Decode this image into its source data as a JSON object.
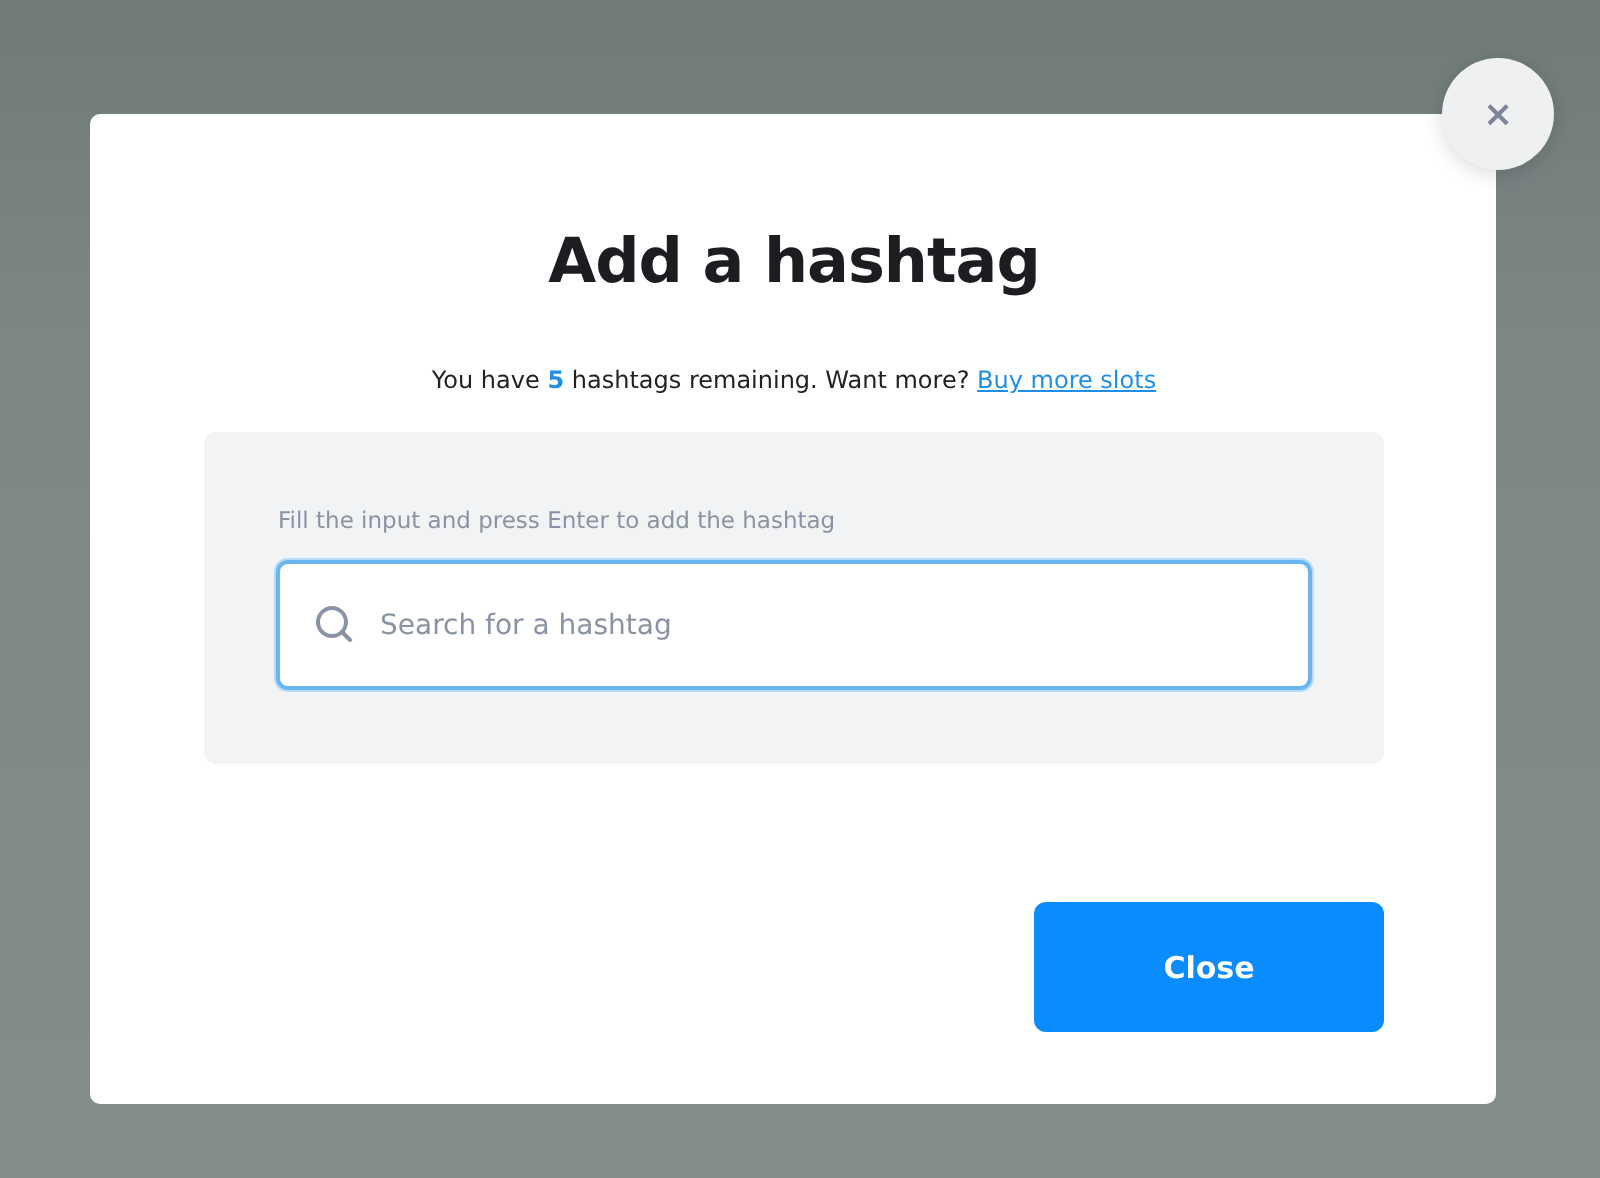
{
  "dialog": {
    "title": "Add a hashtag",
    "message": {
      "before": "You have",
      "count": "5",
      "after": "hashtags remaining. Want more?",
      "link": "Buy more slots"
    },
    "hint": "Fill the input and press Enter to add the hashtag",
    "search": {
      "placeholder": "Search for a hashtag",
      "focused": true
    },
    "buttons": [
      {
        "label": "Close",
        "kind": "primary"
      }
    ],
    "close_icon": "×"
  }
}
